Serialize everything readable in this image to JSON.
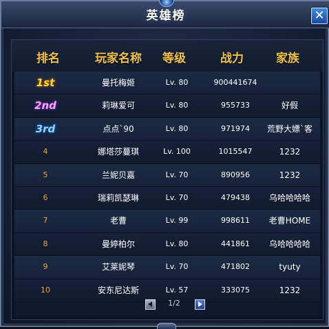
{
  "window": {
    "title": "英雄榜",
    "close_label": "✕"
  },
  "columns": [
    "排名",
    "玩家名称",
    "等级",
    "战力",
    "家族"
  ],
  "rows": [
    {
      "rank": "1st",
      "name": "曼托梅姬",
      "level": "Lv. 80",
      "power": "900441674",
      "family": ""
    },
    {
      "rank": "2nd",
      "name": "莉琳爱可",
      "level": "Lv. 80",
      "power": "955733",
      "family": "好假"
    },
    {
      "rank": "3rd",
      "name": "点点`90",
      "level": "Lv. 80",
      "power": "971974",
      "family": "荒野大嫖`客"
    },
    {
      "rank": "4",
      "name": "娜塔莎蔓琪",
      "level": "Lv. 100",
      "power": "1015547",
      "family": "1232"
    },
    {
      "rank": "5",
      "name": "兰妮贝嘉",
      "level": "Lv. 70",
      "power": "890956",
      "family": "1232"
    },
    {
      "rank": "6",
      "name": "瑞莉凯瑟琳",
      "level": "Lv. 70",
      "power": "479438",
      "family": "乌哈哈哈哈"
    },
    {
      "rank": "7",
      "name": "老曹",
      "level": "Lv. 99",
      "power": "998611",
      "family": "老曹HOME"
    },
    {
      "rank": "8",
      "name": "曼婷柏尔",
      "level": "Lv. 80",
      "power": "441861",
      "family": "乌哈哈哈哈"
    },
    {
      "rank": "9",
      "name": "艾莱妮琴",
      "level": "Lv. 70",
      "power": "471802",
      "family": "tyuty"
    },
    {
      "rank": "10",
      "name": "安东尼达斯",
      "level": "Lv. 57",
      "power": "333075",
      "family": "1232"
    }
  ],
  "pager": {
    "text": "1/2"
  },
  "colors": {
    "header_gold": "#f0c24a",
    "rank_orange": "#f0a830",
    "panel_bg": "#101a2c"
  },
  "icons": {
    "close": "close-icon",
    "prev": "prev-page-icon",
    "next": "next-page-icon"
  }
}
